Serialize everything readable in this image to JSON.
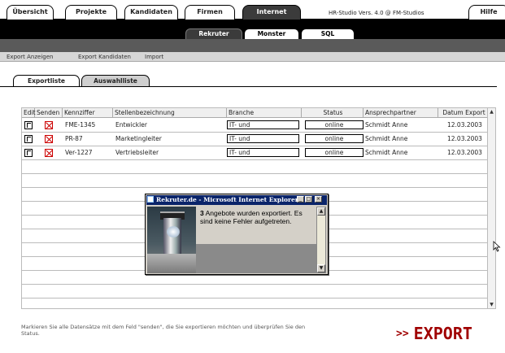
{
  "top_tabs": [
    {
      "label": "Übersicht"
    },
    {
      "label": "Projekte"
    },
    {
      "label": "Kandidaten"
    },
    {
      "label": "Firmen"
    },
    {
      "label": "Internet"
    },
    {
      "label": "Hilfe"
    }
  ],
  "version_text": "HR-Studio Vers. 4.0 @ FM-Studios",
  "sub_tabs": [
    {
      "label": "Rekruter"
    },
    {
      "label": "Monster"
    },
    {
      "label": "SQL"
    }
  ],
  "gray_nav": [
    {
      "label": "Export Anzeigen"
    },
    {
      "label": "Export Kandidaten"
    },
    {
      "label": "Import"
    }
  ],
  "inner_tabs": [
    {
      "label": "Exportliste"
    },
    {
      "label": "Auswahlliste"
    }
  ],
  "table": {
    "headers": [
      "Edit",
      "Senden",
      "Kennziffer",
      "Stellenbezeichnung",
      "Branche",
      "Status",
      "Ansprechpartner",
      "Datum Export"
    ],
    "rows": [
      {
        "kennziffer": "FME-1345",
        "stelle": "Entwickler",
        "branche": "IT- und",
        "status": "online",
        "ansprech": "Schmidt Anne",
        "datum": "12.03.2003"
      },
      {
        "kennziffer": "PR-87",
        "stelle": "Marketingleiter",
        "branche": "IT- und",
        "status": "online",
        "ansprech": "Schmidt Anne",
        "datum": "12.03.2003"
      },
      {
        "kennziffer": "Ver-1227",
        "stelle": "Vertriebsleiter",
        "branche": "IT- und",
        "status": "online",
        "ansprech": "Schmidt Anne",
        "datum": "12.03.2003"
      }
    ]
  },
  "hint": "Markieren Sie alle Datensätze mit dem Feld \"senden\", die Sie exportieren möchten und überprüfen Sie den Status.",
  "export_button": {
    "arrows": ">>",
    "label": "EXPORT"
  },
  "popup": {
    "title": "Rekruter.de - Microsoft Internet Explorer",
    "count": "3",
    "message": " Angebote wurden exportiert. Es sind keine Fehler aufgetreten."
  }
}
